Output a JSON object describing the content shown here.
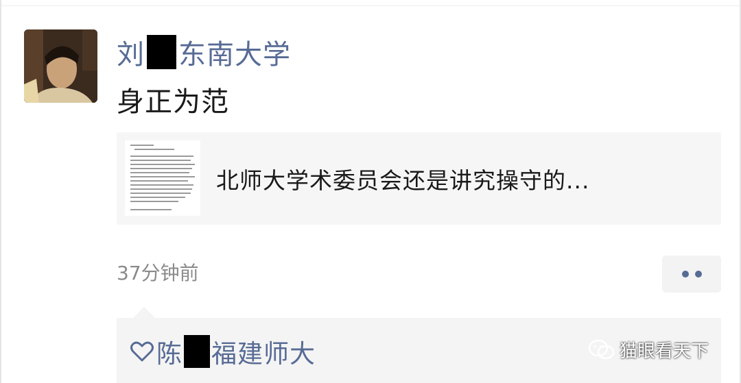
{
  "post": {
    "author_prefix": "刘",
    "author_suffix": "东南大学",
    "text": "身正为范",
    "time": "37分钟前"
  },
  "link_card": {
    "title": "北师大学术委员会还是讲究操守的..."
  },
  "likes": {
    "name_prefix": "陈",
    "name_suffix": "福建师大"
  },
  "watermark": {
    "text": "猫眼看天下"
  },
  "colors": {
    "link_blue": "#576b95",
    "card_bg": "#f6f6f6"
  }
}
